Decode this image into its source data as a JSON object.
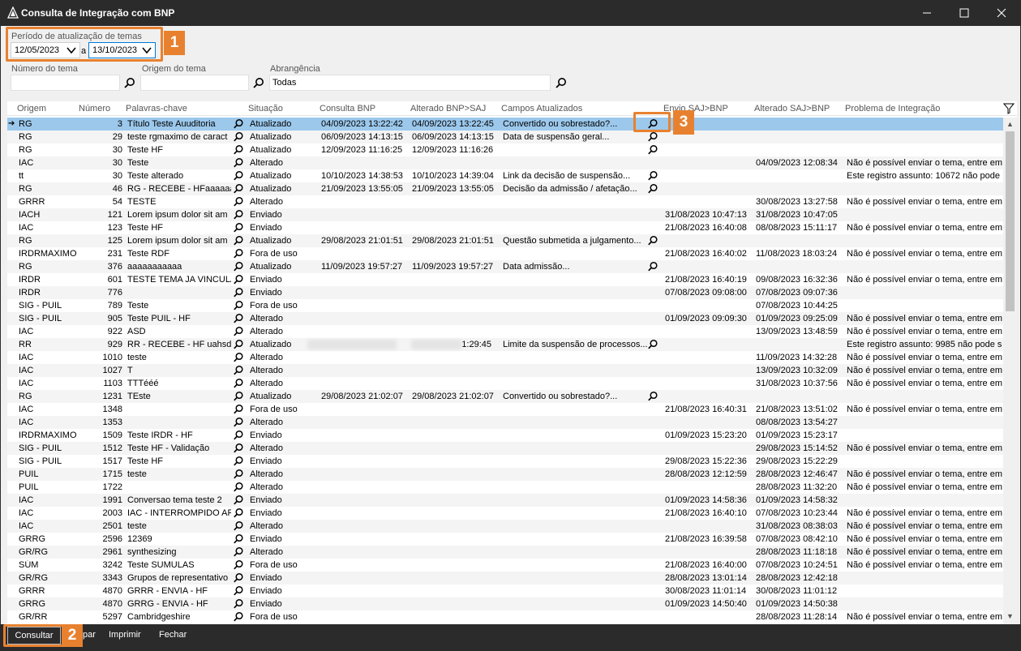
{
  "window": {
    "title": "Consulta de Integração com BNP",
    "minimize_icon": "minimize-icon",
    "maximize_icon": "maximize-icon",
    "close_icon": "close-icon"
  },
  "filters": {
    "period_label": "Período de atualização de temas",
    "date_from": "12/05/2023",
    "date_sep": "a",
    "date_to": "13/10/2023",
    "numero_label": "Número do tema",
    "numero_value": "",
    "origem_label": "Origem do tema",
    "origem_value": "",
    "abrangencia_label": "Abrangência",
    "abrangencia_value": "Todas"
  },
  "badges": [
    "1",
    "2",
    "3"
  ],
  "grid": {
    "columns": [
      "Origem",
      "Número",
      "Palavras-chave",
      "Situação",
      "Consulta BNP",
      "Alterado BNP>SAJ",
      "Campos Atualizados",
      "Envio SAJ>BNP",
      "Alterado SAJ>BNP",
      "Problema de Integração"
    ],
    "rows": [
      {
        "origem": "RG",
        "numero": "3",
        "palavras": "Título Teste Auuditoria",
        "situacao": "Atualizado",
        "consulta": "04/09/2023 13:22:42",
        "alterado_bnp": "04/09/2023 13:22:45",
        "campos": "Convertido ou sobrestado?...",
        "mag2": true,
        "envio": "",
        "alterado_saj": "",
        "problema": ""
      },
      {
        "origem": "RG",
        "numero": "29",
        "palavras": "teste rgmaximo de caract",
        "situacao": "Atualizado",
        "consulta": "06/09/2023 14:13:15",
        "alterado_bnp": "06/09/2023 14:13:15",
        "campos": "Data de suspensão geral...",
        "mag2": true,
        "envio": "",
        "alterado_saj": "",
        "problema": ""
      },
      {
        "origem": "RG",
        "numero": "30",
        "palavras": "Teste HF",
        "situacao": "Atualizado",
        "consulta": "12/09/2023 11:16:25",
        "alterado_bnp": "12/09/2023 11:16:26",
        "campos": "",
        "mag2": true,
        "envio": "",
        "alterado_saj": "",
        "problema": ""
      },
      {
        "origem": "IAC",
        "numero": "30",
        "palavras": "Teste",
        "situacao": "Alterado",
        "consulta": "",
        "alterado_bnp": "",
        "campos": "",
        "mag2": false,
        "envio": "",
        "alterado_saj": "04/09/2023 12:08:34",
        "problema": "Não é possível enviar o tema, entre em"
      },
      {
        "origem": "tt",
        "numero": "30",
        "palavras": "Teste alterado",
        "situacao": "Atualizado",
        "consulta": "10/10/2023 14:38:53",
        "alterado_bnp": "10/10/2023 14:39:04",
        "campos": "Link da decisão de suspensão...",
        "mag2": true,
        "envio": "",
        "alterado_saj": "",
        "problema": "Este registro assunto: 10672 não pode"
      },
      {
        "origem": "RG",
        "numero": "46",
        "palavras": "RG - RECEBE - HFaaaaaaa",
        "situacao": "Atualizado",
        "consulta": "21/09/2023 13:55:05",
        "alterado_bnp": "21/09/2023 13:55:05",
        "campos": "Decisão da admissão / afetação...",
        "mag2": true,
        "envio": "",
        "alterado_saj": "",
        "problema": ""
      },
      {
        "origem": "GRRR",
        "numero": "54",
        "palavras": "TESTE",
        "situacao": "Alterado",
        "consulta": "",
        "alterado_bnp": "",
        "campos": "",
        "mag2": false,
        "envio": "",
        "alterado_saj": "30/08/2023 13:27:58",
        "problema": "Não é possível enviar o tema, entre em"
      },
      {
        "origem": "IACH",
        "numero": "121",
        "palavras": "Lorem ipsum dolor sit am",
        "situacao": "Enviado",
        "consulta": "",
        "alterado_bnp": "",
        "campos": "",
        "mag2": false,
        "envio": "31/08/2023 10:47:13",
        "alterado_saj": "31/08/2023 10:47:05",
        "problema": ""
      },
      {
        "origem": "IAC",
        "numero": "123",
        "palavras": "Teste HF",
        "situacao": "Enviado",
        "consulta": "",
        "alterado_bnp": "",
        "campos": "",
        "mag2": false,
        "envio": "21/08/2023 16:40:08",
        "alterado_saj": "08/08/2023 15:11:17",
        "problema": "Não é possível enviar o tema, entre em"
      },
      {
        "origem": "RG",
        "numero": "125",
        "palavras": "Lorem ipsum dolor sit am",
        "situacao": "Atualizado",
        "consulta": "29/08/2023 21:01:51",
        "alterado_bnp": "29/08/2023 21:01:51",
        "campos": "Questão submetida a julgamento...",
        "mag2": true,
        "envio": "",
        "alterado_saj": "",
        "problema": ""
      },
      {
        "origem": "IRDRMAXIMO",
        "numero": "231",
        "palavras": "Teste RDF",
        "situacao": "Fora de uso",
        "consulta": "",
        "alterado_bnp": "",
        "campos": "",
        "mag2": false,
        "envio": "21/08/2023 16:40:02",
        "alterado_saj": "11/08/2023 18:03:24",
        "problema": "Não é possível enviar o tema, entre em"
      },
      {
        "origem": "RG",
        "numero": "376",
        "palavras": "aaaaaaaaaaa",
        "situacao": "Atualizado",
        "consulta": "11/09/2023 19:57:27",
        "alterado_bnp": "11/09/2023 19:57:27",
        "campos": "Data admissão...",
        "mag2": true,
        "envio": "",
        "alterado_saj": "",
        "problema": ""
      },
      {
        "origem": "IRDR",
        "numero": "601",
        "palavras": "TESTE TEMA JA VINCULAD",
        "situacao": "Enviado",
        "consulta": "",
        "alterado_bnp": "",
        "campos": "",
        "mag2": false,
        "envio": "21/08/2023 16:40:19",
        "alterado_saj": "09/08/2023 16:32:36",
        "problema": "Não é possível enviar o tema, entre em"
      },
      {
        "origem": "IRDR",
        "numero": "776",
        "palavras": "",
        "situacao": "Enviado",
        "consulta": "",
        "alterado_bnp": "",
        "campos": "",
        "mag2": false,
        "envio": "07/08/2023 09:08:00",
        "alterado_saj": "07/08/2023 09:07:36",
        "problema": ""
      },
      {
        "origem": "SIG - PUIL",
        "numero": "789",
        "palavras": "Teste",
        "situacao": "Fora de uso",
        "consulta": "",
        "alterado_bnp": "",
        "campos": "",
        "mag2": false,
        "envio": "",
        "alterado_saj": "07/08/2023 10:44:25",
        "problema": ""
      },
      {
        "origem": "SIG - PUIL",
        "numero": "905",
        "palavras": "Teste PUIL - HF",
        "situacao": "Alterado",
        "consulta": "",
        "alterado_bnp": "",
        "campos": "",
        "mag2": false,
        "envio": "01/09/2023 09:09:30",
        "alterado_saj": "01/09/2023 09:25:09",
        "problema": "Não é possível enviar o tema, entre em"
      },
      {
        "origem": "IAC",
        "numero": "922",
        "palavras": "ASD",
        "situacao": "Alterado",
        "consulta": "",
        "alterado_bnp": "",
        "campos": "",
        "mag2": false,
        "envio": "",
        "alterado_saj": "13/09/2023 13:48:59",
        "problema": "Não é possível enviar o tema, entre em"
      },
      {
        "origem": "RR",
        "numero": "929",
        "palavras": "RR - RECEBE - HF uahsdua",
        "situacao": "Atualizado",
        "consulta": "",
        "alterado_bnp": "1:29:45",
        "campos": "Limite da suspensão de processos...",
        "mag2": true,
        "envio": "",
        "alterado_saj": "",
        "problema": "Este registro assunto: 9985 não pode s",
        "blurred": true
      },
      {
        "origem": "IAC",
        "numero": "1010",
        "palavras": "teste",
        "situacao": "Alterado",
        "consulta": "",
        "alterado_bnp": "",
        "campos": "",
        "mag2": false,
        "envio": "",
        "alterado_saj": "11/09/2023 14:32:28",
        "problema": "Não é possível enviar o tema, entre em"
      },
      {
        "origem": "IAC",
        "numero": "1027",
        "palavras": "T",
        "situacao": "Alterado",
        "consulta": "",
        "alterado_bnp": "",
        "campos": "",
        "mag2": false,
        "envio": "",
        "alterado_saj": "13/09/2023 10:32:09",
        "problema": "Não é possível enviar o tema, entre em"
      },
      {
        "origem": "IAC",
        "numero": "1103",
        "palavras": "TTTééé",
        "situacao": "Alterado",
        "consulta": "",
        "alterado_bnp": "",
        "campos": "",
        "mag2": false,
        "envio": "",
        "alterado_saj": "31/08/2023 10:37:56",
        "problema": "Não é possível enviar o tema, entre em"
      },
      {
        "origem": "RG",
        "numero": "1231",
        "palavras": "TEste",
        "situacao": "Atualizado",
        "consulta": "29/08/2023 21:02:07",
        "alterado_bnp": "29/08/2023 21:02:07",
        "campos": "Convertido ou sobrestado?...",
        "mag2": true,
        "envio": "",
        "alterado_saj": "",
        "problema": ""
      },
      {
        "origem": "IAC",
        "numero": "1348",
        "palavras": "",
        "situacao": "Fora de uso",
        "consulta": "",
        "alterado_bnp": "",
        "campos": "",
        "mag2": false,
        "envio": "21/08/2023 16:40:31",
        "alterado_saj": "21/08/2023 13:51:02",
        "problema": "Não é possível enviar o tema, entre em"
      },
      {
        "origem": "IAC",
        "numero": "1353",
        "palavras": "",
        "situacao": "Alterado",
        "consulta": "",
        "alterado_bnp": "",
        "campos": "",
        "mag2": false,
        "envio": "",
        "alterado_saj": "08/08/2023 13:54:27",
        "problema": ""
      },
      {
        "origem": "IRDRMAXIMO",
        "numero": "1509",
        "palavras": "Teste IRDR - HF",
        "situacao": "Enviado",
        "consulta": "",
        "alterado_bnp": "",
        "campos": "",
        "mag2": false,
        "envio": "01/09/2023 15:23:20",
        "alterado_saj": "01/09/2023 15:23:17",
        "problema": ""
      },
      {
        "origem": "SIG - PUIL",
        "numero": "1512",
        "palavras": "Teste HF - Validação",
        "situacao": "Alterado",
        "consulta": "",
        "alterado_bnp": "",
        "campos": "",
        "mag2": false,
        "envio": "",
        "alterado_saj": "29/08/2023 15:14:52",
        "problema": "Não é possível enviar o tema, entre em"
      },
      {
        "origem": "SIG - PUIL",
        "numero": "1517",
        "palavras": "Teste HF",
        "situacao": "Enviado",
        "consulta": "",
        "alterado_bnp": "",
        "campos": "",
        "mag2": false,
        "envio": "29/08/2023 15:22:36",
        "alterado_saj": "29/08/2023 15:22:29",
        "problema": ""
      },
      {
        "origem": "PUIL",
        "numero": "1715",
        "palavras": "teste",
        "situacao": "Alterado",
        "consulta": "",
        "alterado_bnp": "",
        "campos": "",
        "mag2": false,
        "envio": "28/08/2023 12:12:59",
        "alterado_saj": "28/08/2023 12:46:47",
        "problema": "Não é possível enviar o tema, entre em"
      },
      {
        "origem": "PUIL",
        "numero": "1722",
        "palavras": "",
        "situacao": "Alterado",
        "consulta": "",
        "alterado_bnp": "",
        "campos": "",
        "mag2": false,
        "envio": "",
        "alterado_saj": "28/08/2023 11:32:20",
        "problema": "Não é possível enviar o tema, entre em"
      },
      {
        "origem": "IAC",
        "numero": "1991",
        "palavras": "Conversao tema teste 2",
        "situacao": "Enviado",
        "consulta": "",
        "alterado_bnp": "",
        "campos": "",
        "mag2": false,
        "envio": "01/09/2023 14:58:36",
        "alterado_saj": "01/09/2023 14:58:32",
        "problema": ""
      },
      {
        "origem": "IAC",
        "numero": "2003",
        "palavras": "IAC - INTERROMPIDO APE",
        "situacao": "Enviado",
        "consulta": "",
        "alterado_bnp": "",
        "campos": "",
        "mag2": false,
        "envio": "21/08/2023 16:40:10",
        "alterado_saj": "07/08/2023 10:23:44",
        "problema": "Não é possível enviar o tema, entre em"
      },
      {
        "origem": "IAC",
        "numero": "2501",
        "palavras": "teste",
        "situacao": "Alterado",
        "consulta": "",
        "alterado_bnp": "",
        "campos": "",
        "mag2": false,
        "envio": "",
        "alterado_saj": "31/08/2023 08:38:03",
        "problema": "Não é possível enviar o tema, entre em"
      },
      {
        "origem": "GRRG",
        "numero": "2596",
        "palavras": "12369",
        "situacao": "Enviado",
        "consulta": "",
        "alterado_bnp": "",
        "campos": "",
        "mag2": false,
        "envio": "21/08/2023 16:39:58",
        "alterado_saj": "07/08/2023 08:42:10",
        "problema": "Não é possível enviar o tema, entre em"
      },
      {
        "origem": "GR/RG",
        "numero": "2961",
        "palavras": "synthesizing",
        "situacao": "Alterado",
        "consulta": "",
        "alterado_bnp": "",
        "campos": "",
        "mag2": false,
        "envio": "",
        "alterado_saj": "28/08/2023 11:18:18",
        "problema": "Não é possível enviar o tema, entre em"
      },
      {
        "origem": "SÚM",
        "numero": "3242",
        "palavras": "Teste SUMULAS",
        "situacao": "Fora de uso",
        "consulta": "",
        "alterado_bnp": "",
        "campos": "",
        "mag2": false,
        "envio": "21/08/2023 16:40:00",
        "alterado_saj": "07/08/2023 10:24:51",
        "problema": "Não é possível enviar o tema, entre em"
      },
      {
        "origem": "GR/RG",
        "numero": "3343",
        "palavras": "Grupos de representativo",
        "situacao": "Enviado",
        "consulta": "",
        "alterado_bnp": "",
        "campos": "",
        "mag2": false,
        "envio": "28/08/2023 13:01:14",
        "alterado_saj": "28/08/2023 12:42:18",
        "problema": ""
      },
      {
        "origem": "GRRR",
        "numero": "4870",
        "palavras": "GRRR - ENVIA - HF",
        "situacao": "Enviado",
        "consulta": "",
        "alterado_bnp": "",
        "campos": "",
        "mag2": false,
        "envio": "30/08/2023 11:01:14",
        "alterado_saj": "30/08/2023 11:01:12",
        "problema": ""
      },
      {
        "origem": "GRRG",
        "numero": "4870",
        "palavras": "GRRG - ENVIA - HF",
        "situacao": "Enviado",
        "consulta": "",
        "alterado_bnp": "",
        "campos": "",
        "mag2": false,
        "envio": "01/09/2023 14:50:40",
        "alterado_saj": "01/09/2023 14:50:38",
        "problema": ""
      },
      {
        "origem": "GR/RR",
        "numero": "5297",
        "palavras": "Cambridgeshire",
        "situacao": "Fora de uso",
        "consulta": "",
        "alterado_bnp": "",
        "campos": "",
        "mag2": false,
        "envio": "",
        "alterado_saj": "28/08/2023 11:28:14",
        "problema": "Não é possível enviar o tema, entre em"
      }
    ]
  },
  "footer": {
    "consultar_label": "Consultar",
    "limpar_label": "par",
    "imprimir_label": "Imprimir",
    "fechar_label": "Fechar"
  },
  "colors": {
    "accent": "#e8812f",
    "selection": "#9cc8ec",
    "titlebar": "#2b2b2b"
  }
}
